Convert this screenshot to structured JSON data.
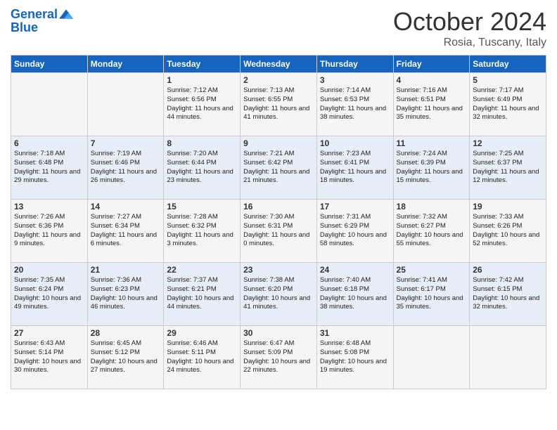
{
  "header": {
    "logo_general": "General",
    "logo_blue": "Blue",
    "month_year": "October 2024",
    "location": "Rosia, Tuscany, Italy"
  },
  "days_of_week": [
    "Sunday",
    "Monday",
    "Tuesday",
    "Wednesday",
    "Thursday",
    "Friday",
    "Saturday"
  ],
  "weeks": [
    [
      null,
      null,
      {
        "day": "1",
        "sunrise": "Sunrise: 7:12 AM",
        "sunset": "Sunset: 6:56 PM",
        "daylight": "Daylight: 11 hours and 44 minutes."
      },
      {
        "day": "2",
        "sunrise": "Sunrise: 7:13 AM",
        "sunset": "Sunset: 6:55 PM",
        "daylight": "Daylight: 11 hours and 41 minutes."
      },
      {
        "day": "3",
        "sunrise": "Sunrise: 7:14 AM",
        "sunset": "Sunset: 6:53 PM",
        "daylight": "Daylight: 11 hours and 38 minutes."
      },
      {
        "day": "4",
        "sunrise": "Sunrise: 7:16 AM",
        "sunset": "Sunset: 6:51 PM",
        "daylight": "Daylight: 11 hours and 35 minutes."
      },
      {
        "day": "5",
        "sunrise": "Sunrise: 7:17 AM",
        "sunset": "Sunset: 6:49 PM",
        "daylight": "Daylight: 11 hours and 32 minutes."
      }
    ],
    [
      {
        "day": "6",
        "sunrise": "Sunrise: 7:18 AM",
        "sunset": "Sunset: 6:48 PM",
        "daylight": "Daylight: 11 hours and 29 minutes."
      },
      {
        "day": "7",
        "sunrise": "Sunrise: 7:19 AM",
        "sunset": "Sunset: 6:46 PM",
        "daylight": "Daylight: 11 hours and 26 minutes."
      },
      {
        "day": "8",
        "sunrise": "Sunrise: 7:20 AM",
        "sunset": "Sunset: 6:44 PM",
        "daylight": "Daylight: 11 hours and 23 minutes."
      },
      {
        "day": "9",
        "sunrise": "Sunrise: 7:21 AM",
        "sunset": "Sunset: 6:42 PM",
        "daylight": "Daylight: 11 hours and 21 minutes."
      },
      {
        "day": "10",
        "sunrise": "Sunrise: 7:23 AM",
        "sunset": "Sunset: 6:41 PM",
        "daylight": "Daylight: 11 hours and 18 minutes."
      },
      {
        "day": "11",
        "sunrise": "Sunrise: 7:24 AM",
        "sunset": "Sunset: 6:39 PM",
        "daylight": "Daylight: 11 hours and 15 minutes."
      },
      {
        "day": "12",
        "sunrise": "Sunrise: 7:25 AM",
        "sunset": "Sunset: 6:37 PM",
        "daylight": "Daylight: 11 hours and 12 minutes."
      }
    ],
    [
      {
        "day": "13",
        "sunrise": "Sunrise: 7:26 AM",
        "sunset": "Sunset: 6:36 PM",
        "daylight": "Daylight: 11 hours and 9 minutes."
      },
      {
        "day": "14",
        "sunrise": "Sunrise: 7:27 AM",
        "sunset": "Sunset: 6:34 PM",
        "daylight": "Daylight: 11 hours and 6 minutes."
      },
      {
        "day": "15",
        "sunrise": "Sunrise: 7:28 AM",
        "sunset": "Sunset: 6:32 PM",
        "daylight": "Daylight: 11 hours and 3 minutes."
      },
      {
        "day": "16",
        "sunrise": "Sunrise: 7:30 AM",
        "sunset": "Sunset: 6:31 PM",
        "daylight": "Daylight: 11 hours and 0 minutes."
      },
      {
        "day": "17",
        "sunrise": "Sunrise: 7:31 AM",
        "sunset": "Sunset: 6:29 PM",
        "daylight": "Daylight: 10 hours and 58 minutes."
      },
      {
        "day": "18",
        "sunrise": "Sunrise: 7:32 AM",
        "sunset": "Sunset: 6:27 PM",
        "daylight": "Daylight: 10 hours and 55 minutes."
      },
      {
        "day": "19",
        "sunrise": "Sunrise: 7:33 AM",
        "sunset": "Sunset: 6:26 PM",
        "daylight": "Daylight: 10 hours and 52 minutes."
      }
    ],
    [
      {
        "day": "20",
        "sunrise": "Sunrise: 7:35 AM",
        "sunset": "Sunset: 6:24 PM",
        "daylight": "Daylight: 10 hours and 49 minutes."
      },
      {
        "day": "21",
        "sunrise": "Sunrise: 7:36 AM",
        "sunset": "Sunset: 6:23 PM",
        "daylight": "Daylight: 10 hours and 46 minutes."
      },
      {
        "day": "22",
        "sunrise": "Sunrise: 7:37 AM",
        "sunset": "Sunset: 6:21 PM",
        "daylight": "Daylight: 10 hours and 44 minutes."
      },
      {
        "day": "23",
        "sunrise": "Sunrise: 7:38 AM",
        "sunset": "Sunset: 6:20 PM",
        "daylight": "Daylight: 10 hours and 41 minutes."
      },
      {
        "day": "24",
        "sunrise": "Sunrise: 7:40 AM",
        "sunset": "Sunset: 6:18 PM",
        "daylight": "Daylight: 10 hours and 38 minutes."
      },
      {
        "day": "25",
        "sunrise": "Sunrise: 7:41 AM",
        "sunset": "Sunset: 6:17 PM",
        "daylight": "Daylight: 10 hours and 35 minutes."
      },
      {
        "day": "26",
        "sunrise": "Sunrise: 7:42 AM",
        "sunset": "Sunset: 6:15 PM",
        "daylight": "Daylight: 10 hours and 32 minutes."
      }
    ],
    [
      {
        "day": "27",
        "sunrise": "Sunrise: 6:43 AM",
        "sunset": "Sunset: 5:14 PM",
        "daylight": "Daylight: 10 hours and 30 minutes."
      },
      {
        "day": "28",
        "sunrise": "Sunrise: 6:45 AM",
        "sunset": "Sunset: 5:12 PM",
        "daylight": "Daylight: 10 hours and 27 minutes."
      },
      {
        "day": "29",
        "sunrise": "Sunrise: 6:46 AM",
        "sunset": "Sunset: 5:11 PM",
        "daylight": "Daylight: 10 hours and 24 minutes."
      },
      {
        "day": "30",
        "sunrise": "Sunrise: 6:47 AM",
        "sunset": "Sunset: 5:09 PM",
        "daylight": "Daylight: 10 hours and 22 minutes."
      },
      {
        "day": "31",
        "sunrise": "Sunrise: 6:48 AM",
        "sunset": "Sunset: 5:08 PM",
        "daylight": "Daylight: 10 hours and 19 minutes."
      },
      null,
      null
    ]
  ]
}
